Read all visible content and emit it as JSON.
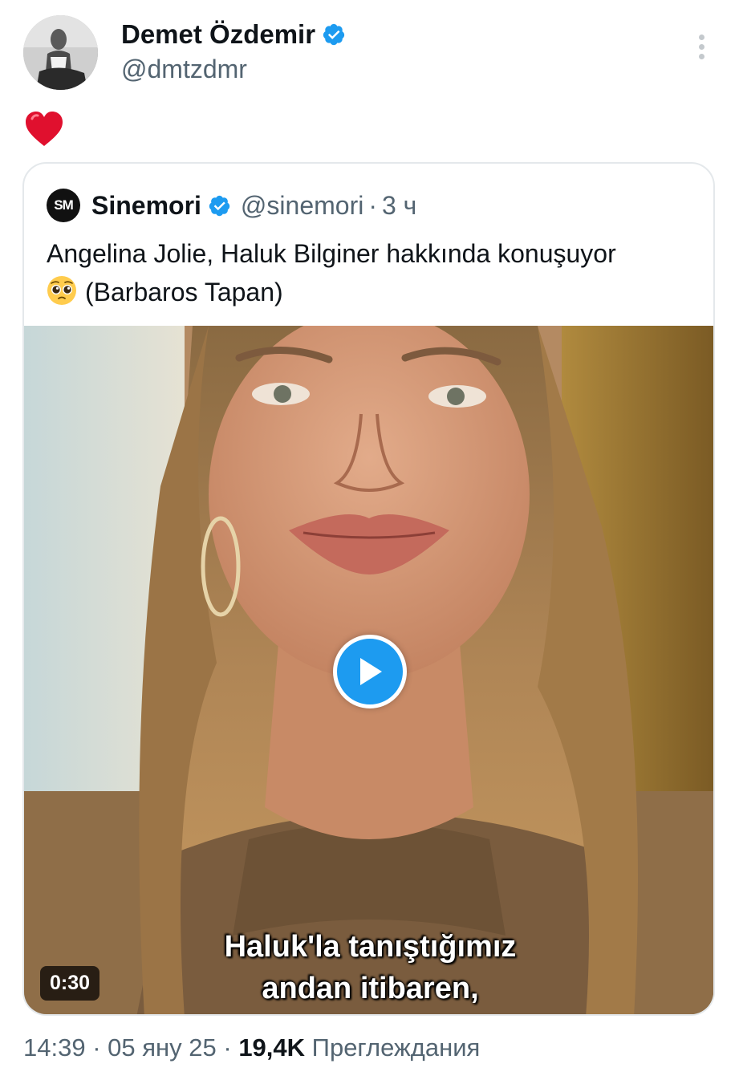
{
  "tweet": {
    "author": {
      "name": "Demet Özdemir",
      "handle": "@dmtzdmr",
      "verified": true
    },
    "text_icon": "red-heart-icon",
    "quote": {
      "author_name": "Sinemori",
      "logo_text": "SM",
      "handle": "@sinemori",
      "separator": "·",
      "time": "3 ч",
      "text_line1": "Angelina Jolie, Haluk Bilginer hakkında konuşuyor",
      "text_emoji": "pleading-face-icon",
      "text_line2": "(Barbaros Tapan)",
      "media": {
        "duration": "0:30",
        "subtitle_line1": "Haluk'la tanıştığımız",
        "subtitle_line2": "andan itibaren,"
      }
    },
    "meta": {
      "time": "14:39",
      "sep1": " · ",
      "date": "05 яну 25",
      "sep2": " · ",
      "views_count": "19,4K",
      "views_label": "Преглеждания"
    }
  },
  "colors": {
    "verified_blue": "#1d9bf0",
    "heart_red": "#f91880",
    "secondary_text": "#536471",
    "border": "#e4e8eb"
  }
}
